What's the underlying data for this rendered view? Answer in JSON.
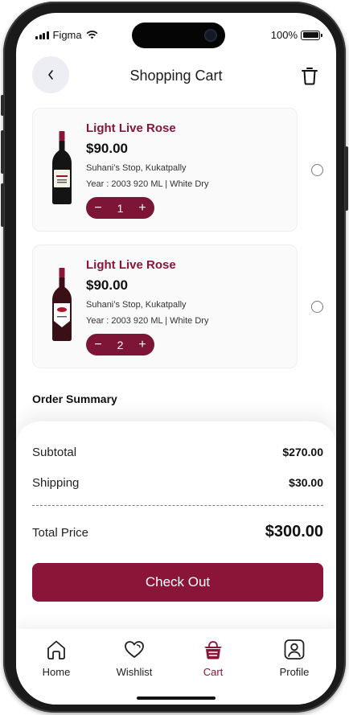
{
  "status_bar": {
    "carrier": "Figma",
    "battery": "100%"
  },
  "header": {
    "title": "Shopping Cart"
  },
  "cart": {
    "items": [
      {
        "name": "Light Live Rose",
        "price": "$90.00",
        "store": "Suhani’s Stop, Kukatpally",
        "meta": "Year : 2003   920 ML  |  White Dry",
        "qty": "1",
        "label_color": "#f3f0e6"
      },
      {
        "name": "Light Live Rose",
        "price": "$90.00",
        "store": "Suhani’s Stop, Kukatpally",
        "meta": "Year : 2003   920 ML  |  White Dry",
        "qty": "2",
        "label_color": "#ffffff"
      }
    ],
    "minus": "−",
    "plus": "+"
  },
  "summary": {
    "title": "Order Summary",
    "subtotal_label": "Subtotal",
    "subtotal_value": "$270.00",
    "shipping_label": "Shipping",
    "shipping_value": "$30.00",
    "total_label": "Total Price",
    "total_value": "$300.00",
    "checkout_label": "Check Out"
  },
  "tabs": [
    {
      "label": "Home",
      "icon": "home-icon"
    },
    {
      "label": "Wishlist",
      "icon": "heart-icon"
    },
    {
      "label": "Cart",
      "icon": "basket-icon",
      "active": true
    },
    {
      "label": "Profile",
      "icon": "profile-icon"
    }
  ],
  "colors": {
    "accent": "#8a1538",
    "stepper": "#7d1636",
    "card_bg": "#fafafa"
  }
}
